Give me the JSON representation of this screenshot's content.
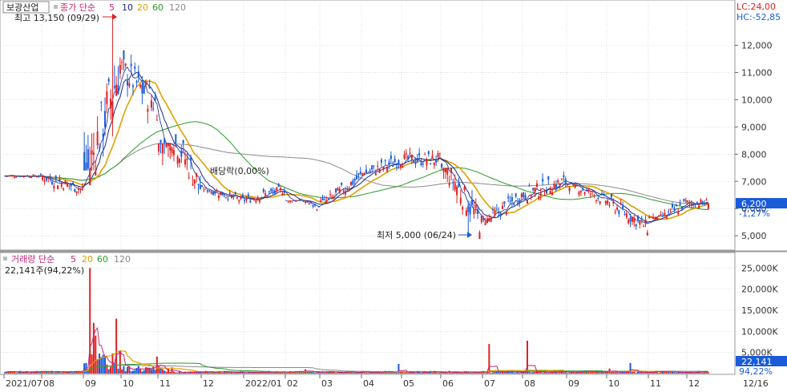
{
  "price_header": {
    "stock_name": "보광산업",
    "indicator": "종가 단순",
    "ma_periods": [
      "5",
      "10",
      "20",
      "60",
      "120"
    ]
  },
  "volume_header": {
    "indicator": "거래량 단순",
    "ma_periods": [
      "5",
      "20",
      "60",
      "120"
    ],
    "current_volume": "22,141주(94,22%)"
  },
  "right_info": {
    "lc": "LC:24,00",
    "hc": "HC:-52,85"
  },
  "annotations": {
    "high": "최고 13,150 (09/29)",
    "low": "최저 5,000 (06/24)",
    "dividend": "배당락(0,00%)"
  },
  "current_price": {
    "value": "6,200",
    "change": "-1,27%"
  },
  "current_volume_box": {
    "value": "22,141",
    "pct": "94,22%"
  },
  "price_axis_labels": [
    "12,000",
    "11,000",
    "10,000",
    "9,000",
    "8,000",
    "7,000",
    "6,000",
    "5,000"
  ],
  "volume_axis_labels": [
    "25,000K",
    "20,000K",
    "15,000K",
    "10,000K",
    "5,000K"
  ],
  "x_axis_labels": [
    "2021/07",
    "08",
    "09",
    "10",
    "11",
    "12",
    "2022/01",
    "02",
    "03",
    "04",
    "05",
    "06",
    "07",
    "08",
    "09",
    "10",
    "11",
    "12",
    "12/16"
  ],
  "colors": {
    "up": "#e02020",
    "down": "#1a5bd8",
    "ma5": "#1a2a8a",
    "ma10": "#1a2a8a",
    "ma20": "#e0a000",
    "ma60": "#2a9a2a",
    "ma120": "#8a8a8a",
    "grid": "#c8c8c8",
    "axis_text": "#333333"
  },
  "chart_data": {
    "type": "candlestick",
    "price_range": [
      4750,
      13150
    ],
    "volume_range": [
      0,
      26000000
    ],
    "x_months": [
      {
        "label": "2021/07",
        "close": 7200,
        "low": 7100,
        "high": 7400
      },
      {
        "label": "08",
        "close": 6700,
        "low": 6100,
        "high": 7300
      },
      {
        "label": "09",
        "close": 11200,
        "low": 7400,
        "high": 13150
      },
      {
        "label": "10",
        "close": 9800,
        "low": 8800,
        "high": 11800
      },
      {
        "label": "11",
        "close": 6800,
        "low": 5400,
        "high": 8400
      },
      {
        "label": "12",
        "close": 6300,
        "low": 6000,
        "high": 6800
      },
      {
        "label": "2022/01",
        "close": 6700,
        "low": 6100,
        "high": 7000
      },
      {
        "label": "02",
        "close": 6000,
        "low": 5800,
        "high": 6300
      },
      {
        "label": "03",
        "close": 7200,
        "low": 6300,
        "high": 7600
      },
      {
        "label": "04",
        "close": 7800,
        "low": 7300,
        "high": 8600
      },
      {
        "label": "05",
        "close": 7800,
        "low": 7200,
        "high": 8600
      },
      {
        "label": "06",
        "close": 5400,
        "low": 5000,
        "high": 7500
      },
      {
        "label": "07",
        "close": 6500,
        "low": 5500,
        "high": 6900
      },
      {
        "label": "08",
        "close": 7000,
        "low": 6300,
        "high": 7800
      },
      {
        "label": "09",
        "close": 6300,
        "low": 5900,
        "high": 6900
      },
      {
        "label": "10",
        "close": 5300,
        "low": 5000,
        "high": 6400
      },
      {
        "label": "11",
        "close": 6200,
        "low": 5700,
        "high": 6800
      },
      {
        "label": "12",
        "close": 6200,
        "low": 6000,
        "high": 6900
      }
    ],
    "high_point": {
      "value": 13150,
      "date": "09/29"
    },
    "low_point": {
      "value": 5000,
      "date": "06/24"
    },
    "last_close": 6200,
    "last_change_pct": -1.27,
    "last_volume": 22141,
    "peak_volume": 25000000
  }
}
